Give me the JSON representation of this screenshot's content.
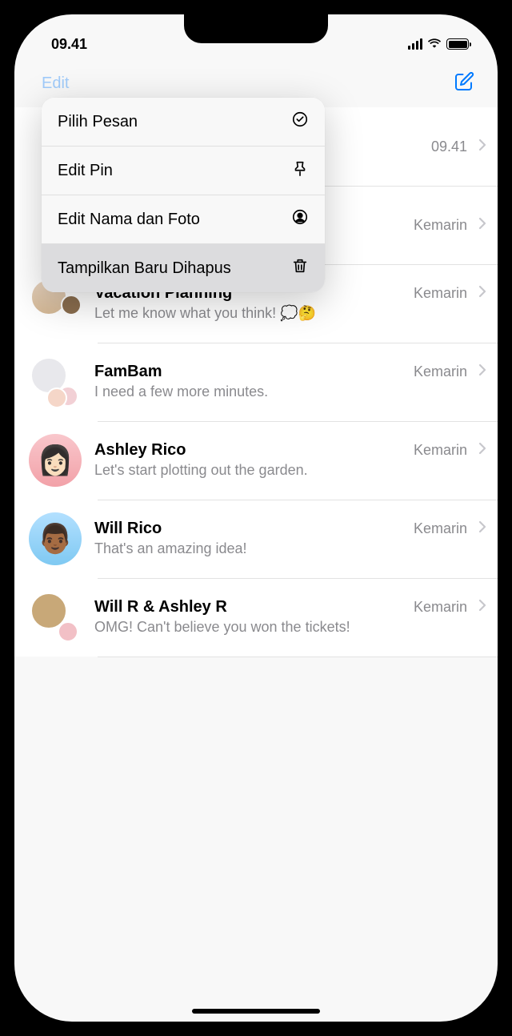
{
  "statusBar": {
    "time": "09.41"
  },
  "nav": {
    "editLabel": "Edit"
  },
  "editMenu": {
    "items": [
      {
        "label": "Pilih Pesan",
        "icon": "checkmark-circle"
      },
      {
        "label": "Edit Pin",
        "icon": "pin"
      },
      {
        "label": "Edit Nama dan Foto",
        "icon": "person-circle"
      },
      {
        "label": "Tampilkan Baru Dihapus",
        "icon": "trash"
      }
    ]
  },
  "hiddenRows": {
    "row0": {
      "time": "09.41"
    },
    "row1": {
      "time": "Kemarin"
    }
  },
  "conversations": [
    {
      "name": "Vacation Planning",
      "preview": "Let me know what you think! 💭🤔",
      "time": "Kemarin",
      "avatarType": "group"
    },
    {
      "name": "FamBam",
      "preview": "I need a few more minutes.",
      "time": "Kemarin",
      "avatarType": "group"
    },
    {
      "name": "Ashley Rico",
      "preview": "Let's start plotting out the garden.",
      "time": "Kemarin",
      "avatarType": "pink"
    },
    {
      "name": "Will Rico",
      "preview": "That's an amazing idea!",
      "time": "Kemarin",
      "avatarType": "blue"
    },
    {
      "name": "Will R & Ashley R",
      "preview": "OMG! Can't believe you won the tickets!",
      "time": "Kemarin",
      "avatarType": "group"
    }
  ]
}
